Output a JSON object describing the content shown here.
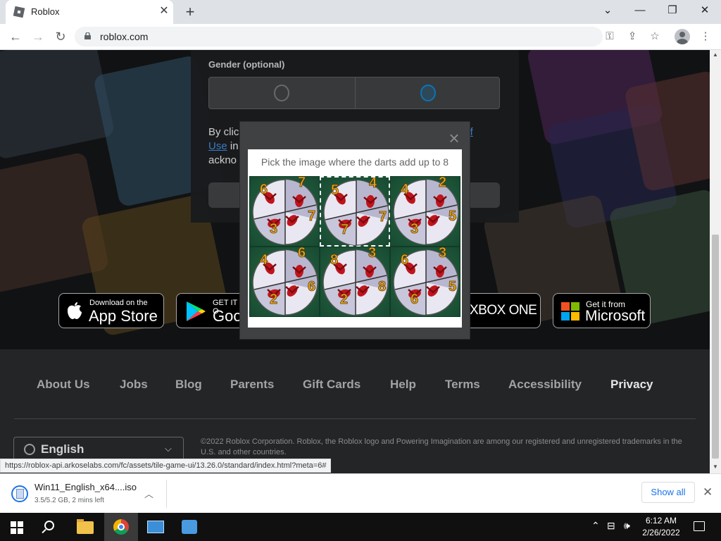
{
  "browser": {
    "tab_title": "Roblox",
    "url": "roblox.com",
    "status_url": "https://roblox-api.arkoselabs.com/fc/assets/tile-game-ui/13.26.0/standard/index.html?meta=6#"
  },
  "signup": {
    "gender_label": "Gender (optional)",
    "terms_line1_start": "By clic",
    "terms_line1_link": "of",
    "terms_line2_link": "Use",
    "terms_line2_rest": " in",
    "terms_line3": "ackno"
  },
  "captcha": {
    "prompt": "Pick the image where the darts add up to 8",
    "close_glyph": "×",
    "tiles": [
      {
        "numbers": [
          "6",
          "7",
          "7",
          "3"
        ],
        "selected": false
      },
      {
        "numbers": [
          "5",
          "4",
          "7",
          "7"
        ],
        "selected": true
      },
      {
        "numbers": [
          "4",
          "2",
          "5",
          "3"
        ],
        "selected": false
      },
      {
        "numbers": [
          "4",
          "6",
          "6",
          "2"
        ],
        "selected": false
      },
      {
        "numbers": [
          "8",
          "3",
          "8",
          "2"
        ],
        "selected": false
      },
      {
        "numbers": [
          "6",
          "3",
          "5",
          "6"
        ],
        "selected": false
      }
    ]
  },
  "stores": {
    "apple_small": "Download on the",
    "apple_big": "App Store",
    "google_small": "GET IT O",
    "google_big": "Goo",
    "xbox_big": "XBOX ONE",
    "ms_small": "Get it from",
    "ms_big": "Microsoft"
  },
  "footer": {
    "links": [
      "About Us",
      "Jobs",
      "Blog",
      "Parents",
      "Gift Cards",
      "Help",
      "Terms",
      "Accessibility",
      "Privacy"
    ],
    "language": "English",
    "copyright": "©2022 Roblox Corporation. Roblox, the Roblox logo and Powering Imagination are among our registered and unregistered trademarks in the U.S. and other countries."
  },
  "download": {
    "filename": "Win11_English_x64....iso",
    "status": "3.5/5.2 GB, 2 mins left",
    "show_all": "Show all"
  },
  "taskbar": {
    "time": "6:12 AM",
    "date": "2/26/2022"
  },
  "colors": {
    "accent_link": "#3d7fc9",
    "chrome_blue": "#1a73e8",
    "dart_red": "#c0141c",
    "dart_number": "#f0a81c"
  }
}
